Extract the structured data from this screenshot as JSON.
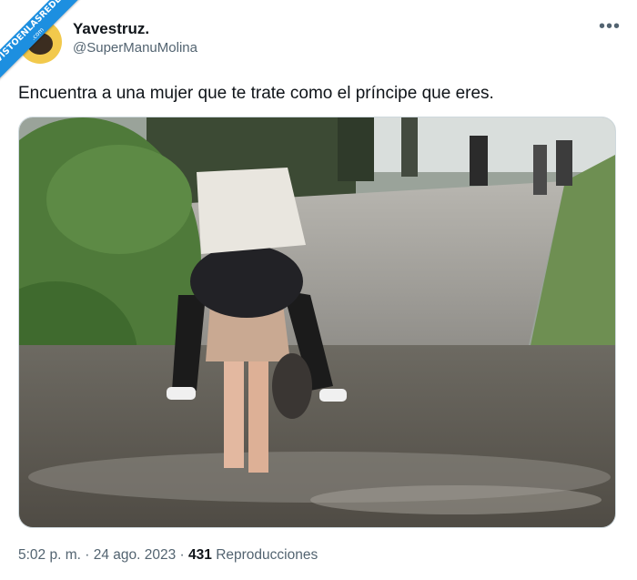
{
  "watermark": {
    "text": "VISTOENLASREDES",
    "sub": ".com"
  },
  "author": {
    "name": "Yavestruz.",
    "handle": "@SuperManuMolina"
  },
  "more_icon": "ellipsis-icon",
  "tweet": {
    "text": "Encuentra a una mujer que te trate como el príncipe que eres."
  },
  "meta": {
    "time": "5:02 p. m.",
    "sep1": " · ",
    "date": "24 ago. 2023",
    "sep2": " · ",
    "views": "431",
    "views_label": " Reproducciones"
  },
  "colors": {
    "text": "#0f1419",
    "secondary": "#536471",
    "ribbon": "#1d8fe0",
    "border": "#cfd9de"
  }
}
